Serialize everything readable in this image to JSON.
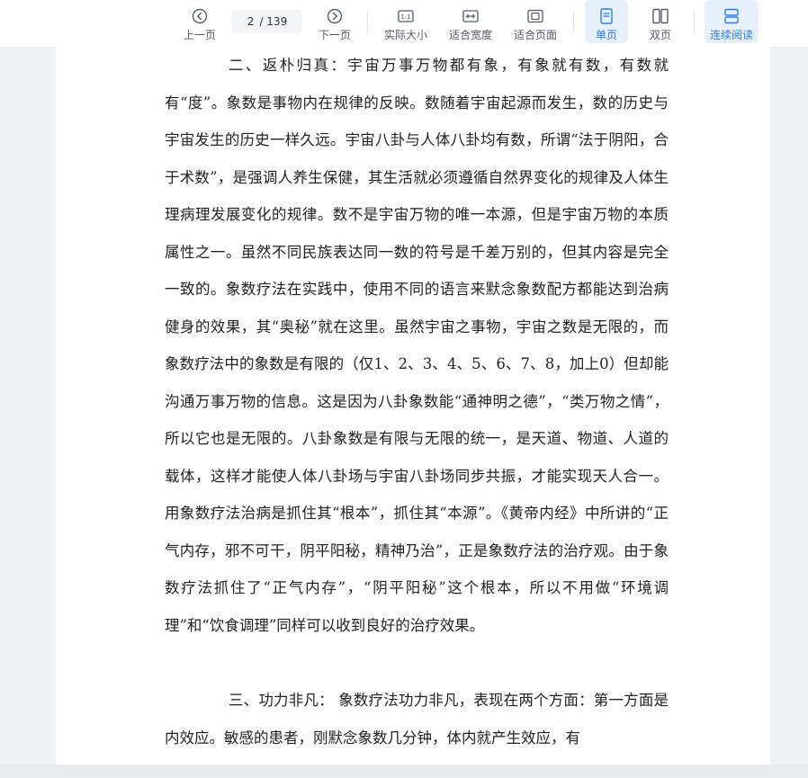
{
  "toolbar": {
    "prev_label": "上一页",
    "next_label": "下一页",
    "page_current": "2",
    "page_total": "/ 139",
    "actual_size_label": "实际大小",
    "fit_width_label": "适合宽度",
    "fit_page_label": "适合页面",
    "single_page_label": "单页",
    "double_page_label": "双页",
    "continuous_label": "连续阅读",
    "active_color": "#2b7de9"
  },
  "document": {
    "paragraph_1": "二、返朴归真：宇宙万事万物都有象，有象就有数，有数就有“度”。象数是事物内在规律的反映。数随着宇宙起源而发生，数的历史与宇宙发生的历史一样久远。宇宙八卦与人体八卦均有数，所谓“法于阴阳，合于术数”，是强调人养生保健，其生活就必须遵循自然界变化的规律及人体生理病理发展变化的规律。数不是宇宙万物的唯一本源，但是宇宙万物的本质属性之一。虽然不同民族表达同一数的符号是千差万别的，但其内容是完全一致的。象数疗法在实践中，使用不同的语言来默念象数配方都能达到治病健身的效果，其“奥秘”就在这里。虽然宇宙之事物，宇宙之数是无限的，而象数疗法中的象数是有限的（仅1、2、3、4、5、6、7、8，加上0）但却能沟通万事万物的信息。这是因为八卦象数能“通神明之德”，“类万物之情”，所以它也是无限的。八卦象数是有限与无限的统一，是天道、物道、人道的载体，这样才能使人体八卦场与宇宙八卦场同步共振，才能实现天人合一。 用象数疗法治病是抓住其“根本”，抓住其“本源”。《黄帝内经》中所讲的“正气内存，邪不可干，阴平阳秘，精神乃治”，正是象数疗法的治疗观。由于象数疗法抓住了“正气内存”，“阴平阳秘”这个根本，所以不用做“环境调理”和“饮食调理”同样可以收到良好的治疗效果。",
    "paragraph_2": "三、功力非凡： 象数疗法功力非凡，表现在两个方面：第一方面是内效应。敏感的患者，刚默念象数几分钟，体内就产生效应，有"
  }
}
